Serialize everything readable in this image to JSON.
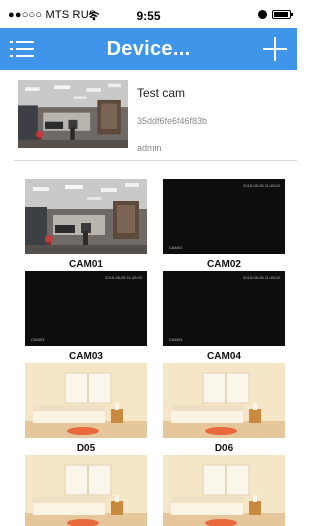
{
  "status_bar": {
    "carrier": "●●○○○ MTS RUS",
    "time": "9:55",
    "battery_level": 0.9
  },
  "nav": {
    "title": "Device...",
    "menu_icon": "hamburger-menu-icon",
    "add_icon": "plus-icon",
    "background": "#3e95ea"
  },
  "device": {
    "name": "Test cam",
    "id": "35ddf6fe6f46f83b",
    "user": "admin"
  },
  "cameras": [
    {
      "label": "CAM01",
      "feed": "office"
    },
    {
      "label": "CAM02",
      "feed": "offline",
      "timestamp": "2015-08-08 11:45:02",
      "channel": "CAM02"
    },
    {
      "label": "CAM03",
      "feed": "offline",
      "timestamp": "2015-08-08 11:45:02",
      "channel": "CAM03"
    },
    {
      "label": "CAM04",
      "feed": "offline",
      "timestamp": "2015-08-08 11:45:02",
      "channel": "CAM04"
    },
    {
      "label": "D05",
      "feed": "bedroom"
    },
    {
      "label": "D06",
      "feed": "bedroom"
    },
    {
      "label": "",
      "feed": "bedroom"
    },
    {
      "label": "",
      "feed": "bedroom"
    }
  ]
}
